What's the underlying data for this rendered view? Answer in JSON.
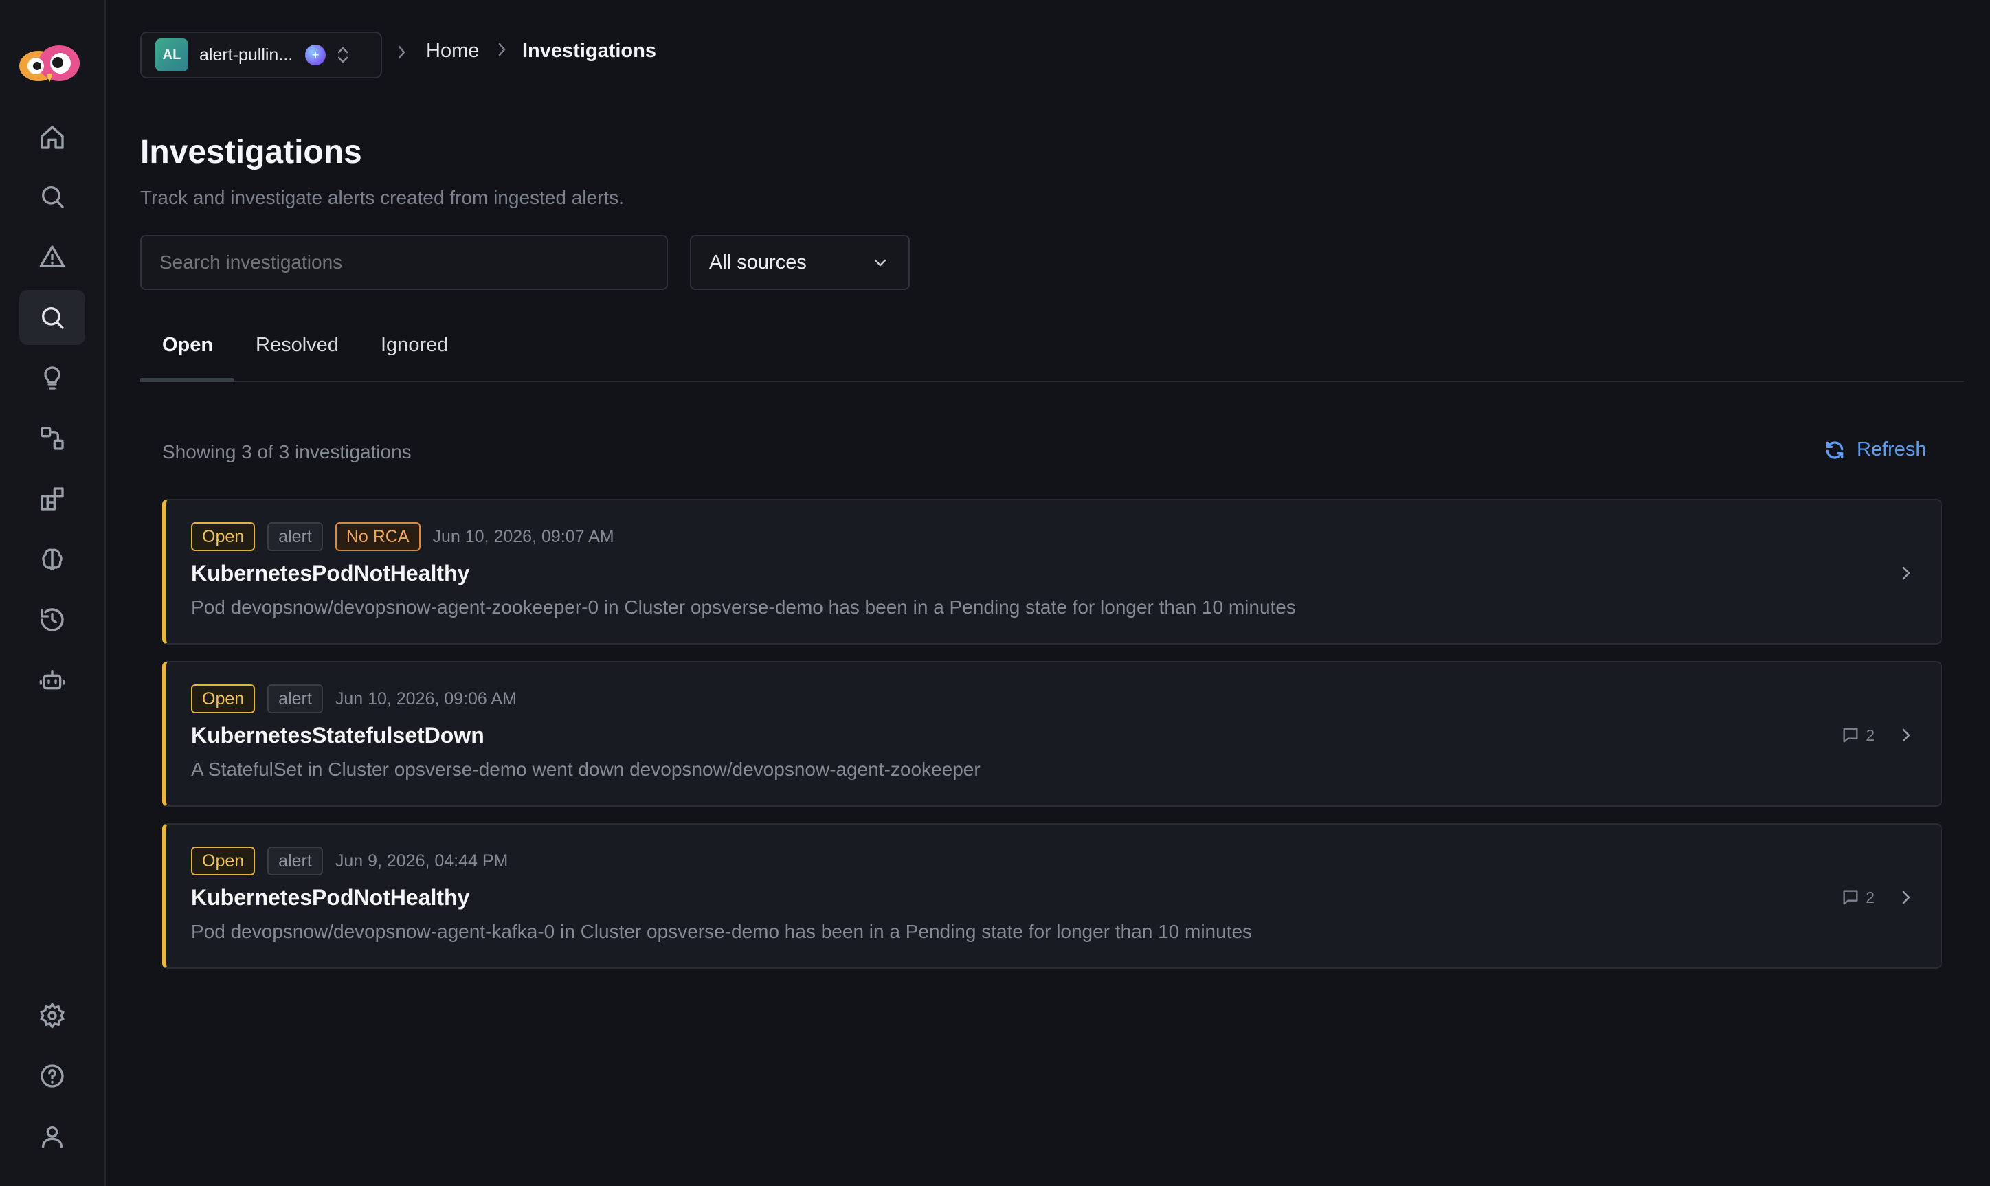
{
  "workspace": {
    "initials": "AL",
    "name": "alert-pullin...",
    "dot_symbol": "+"
  },
  "breadcrumb": {
    "home": "Home",
    "current": "Investigations"
  },
  "page": {
    "title": "Investigations",
    "subtitle": "Track and investigate alerts created from ingested alerts."
  },
  "search": {
    "placeholder": "Search investigations"
  },
  "source_filter": {
    "selected": "All sources"
  },
  "tabs": [
    {
      "label": "Open",
      "active": true
    },
    {
      "label": "Resolved",
      "active": false
    },
    {
      "label": "Ignored",
      "active": false
    }
  ],
  "summary": {
    "showing": "Showing 3 of 3 investigations",
    "refresh_label": "Refresh"
  },
  "colors": {
    "accent_bar": "#e9b53c",
    "link": "#5b9cf0",
    "open_badge": "#f0c45c",
    "no_rca_badge": "#f0a861"
  },
  "investigations": [
    {
      "status": "Open",
      "type": "alert",
      "rca": "No RCA",
      "date": "Jun 10, 2026, 09:07 AM",
      "title": "KubernetesPodNotHealthy",
      "description": "Pod devopsnow/devopsnow-agent-zookeeper-0 in Cluster opsverse-demo has been in a Pending state for longer than 10 minutes",
      "comments": ""
    },
    {
      "status": "Open",
      "type": "alert",
      "rca": "",
      "date": "Jun 10, 2026, 09:06 AM",
      "title": "KubernetesStatefulsetDown",
      "description": "A StatefulSet in Cluster opsverse-demo went down devopsnow/devopsnow-agent-zookeeper",
      "comments": "2"
    },
    {
      "status": "Open",
      "type": "alert",
      "rca": "",
      "date": "Jun 9, 2026, 04:44 PM",
      "title": "KubernetesPodNotHealthy",
      "description": "Pod devopsnow/devopsnow-agent-kafka-0 in Cluster opsverse-demo has been in a Pending state for longer than 10 minutes",
      "comments": "2"
    }
  ],
  "sidebar_icons": [
    "home-icon",
    "search-icon",
    "alert-triangle-icon",
    "investigations-search-icon",
    "lightbulb-icon",
    "workflow-icon",
    "integrations-icon",
    "brain-icon",
    "history-icon",
    "bot-icon",
    "settings-gear-icon",
    "help-circle-icon",
    "user-icon"
  ]
}
